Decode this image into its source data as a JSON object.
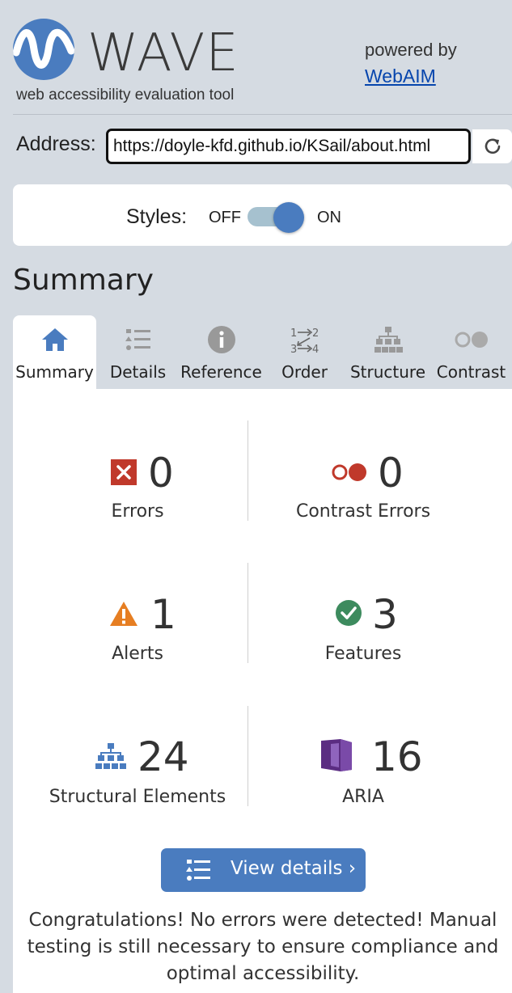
{
  "header": {
    "app_title": "WAVE",
    "tagline": "web accessibility evaluation tool",
    "powered_by": "powered by",
    "webaim_link": "WebAIM"
  },
  "address": {
    "label": "Address:",
    "value": "https://doyle-kfd.github.io/KSail/about.html"
  },
  "styles": {
    "label": "Styles:",
    "off_label": "OFF",
    "on_label": "ON",
    "state": "on"
  },
  "summary_heading": "Summary",
  "tabs": [
    {
      "label": "Summary",
      "icon": "home-icon",
      "active": true
    },
    {
      "label": "Details",
      "icon": "details-list-icon",
      "active": false
    },
    {
      "label": "Reference",
      "icon": "info-icon",
      "active": false
    },
    {
      "label": "Order",
      "icon": "order-icon",
      "active": false
    },
    {
      "label": "Structure",
      "icon": "structure-icon",
      "active": false
    },
    {
      "label": "Contrast",
      "icon": "contrast-icon",
      "active": false
    }
  ],
  "stats": {
    "errors": {
      "count": "0",
      "label": "Errors",
      "icon": "error-icon"
    },
    "contrast_errors": {
      "count": "0",
      "label": "Contrast Errors",
      "icon": "contrast-error-icon"
    },
    "alerts": {
      "count": "1",
      "label": "Alerts",
      "icon": "alert-icon"
    },
    "features": {
      "count": "3",
      "label": "Features",
      "icon": "feature-check-icon"
    },
    "structural": {
      "count": "24",
      "label": "Structural Elements",
      "icon": "structure-icon"
    },
    "aria": {
      "count": "16",
      "label": "ARIA",
      "icon": "aria-icon"
    }
  },
  "view_details_label": "View details ›",
  "congrats_message": "Congratulations! No errors were detected! Manual testing is still necessary to ensure compliance and optimal accessibility.",
  "colors": {
    "accent": "#4a7cbf",
    "error": "#c0392b",
    "alert": "#e67e22",
    "feature": "#3d8b5e",
    "aria": "#5b2d82",
    "background": "#d5dbe2"
  }
}
